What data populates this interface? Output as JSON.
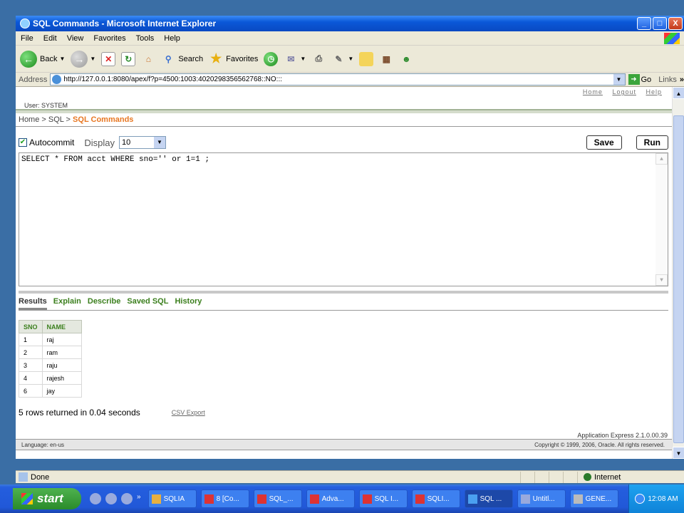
{
  "window": {
    "title": "SQL Commands - Microsoft Internet Explorer",
    "minimize": "_",
    "maximize": "□",
    "close": "X"
  },
  "menu": [
    "File",
    "Edit",
    "View",
    "Favorites",
    "Tools",
    "Help"
  ],
  "toolbar": {
    "back": "Back",
    "search": "Search",
    "favorites": "Favorites"
  },
  "address": {
    "label": "Address",
    "url": "http://127.0.0.1:8080/apex/f?p=4500:1003:4020298356562768::NO:::",
    "go": "Go",
    "links": "Links"
  },
  "page": {
    "links": {
      "home": "Home",
      "logout": "Logout",
      "help": "Help"
    },
    "user": "User: SYSTEM",
    "breadcrumb": {
      "home": "Home",
      "sep1": " > ",
      "sql": "SQL",
      "sep2": " > ",
      "current": "SQL Commands"
    },
    "autocommit": "Autocommit",
    "display_label": "Display",
    "display_value": "10",
    "save": "Save",
    "run": "Run",
    "sql": "SELECT * FROM acct WHERE sno='' or 1=1 ;",
    "tabs": [
      "Results",
      "Explain",
      "Describe",
      "Saved SQL",
      "History"
    ],
    "results": {
      "columns": [
        "SNO",
        "NAME"
      ],
      "rows": [
        [
          "1",
          "raj"
        ],
        [
          "2",
          "ram"
        ],
        [
          "3",
          "raju"
        ],
        [
          "4",
          "rajesh"
        ],
        [
          "6",
          "jay"
        ]
      ]
    },
    "summary": "5 rows returned in 0.04 seconds",
    "csv": "CSV Export",
    "version": "Application Express 2.1.0.00.39",
    "language": "Language: en-us",
    "copyright": "Copyright © 1999, 2006, Oracle. All rights reserved."
  },
  "status": {
    "done": "Done",
    "zone": "Internet"
  },
  "taskbar": {
    "start": "start",
    "tasks": [
      "SQLIA",
      "8 [Co...",
      "SQL_...",
      "Adva...",
      "SQL I...",
      "SQLI...",
      "SQL ...",
      "Untitl...",
      "GENE..."
    ],
    "active_index": 6,
    "clock": "12:08 AM"
  }
}
